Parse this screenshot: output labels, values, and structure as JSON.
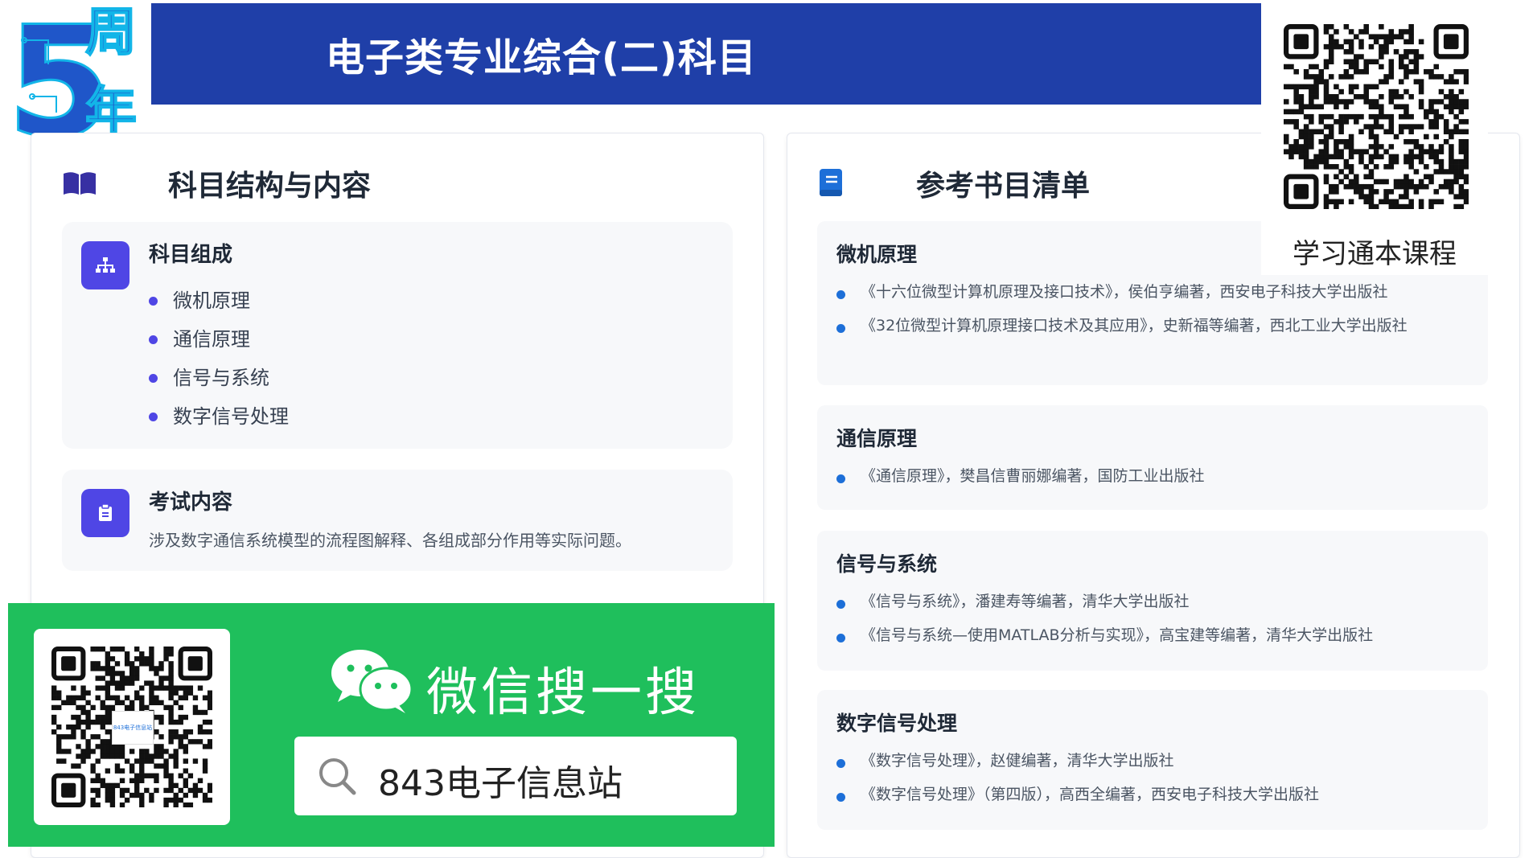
{
  "header": {
    "title": "电子类专业综合(二)科目"
  },
  "logo": {
    "number": "5",
    "text_top": "周",
    "text_bottom": "年"
  },
  "left_card": {
    "title": "科目结构与内容",
    "icon": "book-open-icon",
    "composition": {
      "heading": "科目组成",
      "icon": "hierarchy-icon",
      "items": [
        "微机原理",
        "通信原理",
        "信号与系统",
        "数字信号处理"
      ]
    },
    "exam": {
      "heading": "考试内容",
      "icon": "clipboard-icon",
      "description": "涉及数字通信系统模型的流程图解释、各组成部分作用等实际问题。"
    }
  },
  "right_card": {
    "title": "参考书目清单",
    "icon": "book-icon",
    "groups": [
      {
        "heading": "微机原理",
        "books": [
          "《十六位微型计算机原理及接口技术》，侯伯亨编著，西安电子科技大学出版社",
          "《32位微型计算机原理接口技术及其应用》，史新福等编著，西北工业大学出版社"
        ]
      },
      {
        "heading": "通信原理",
        "books": [
          "《通信原理》，樊昌信曹丽娜编著，国防工业出版社"
        ]
      },
      {
        "heading": "信号与系统",
        "books": [
          "《信号与系统》，潘建寿等编著，清华大学出版社",
          "《信号与系统—使用MATLAB分析与实现》，高宝建等编著，清华大学出版社"
        ]
      },
      {
        "heading": "数字信号处理",
        "books": [
          "《数字信号处理》，赵健编著，清华大学出版社",
          "《数字信号处理》（第四版），高西全编著，西安电子科技大学出版社"
        ]
      }
    ]
  },
  "qr_top": {
    "caption": "学习通本课程"
  },
  "wechat": {
    "title": "微信搜一搜",
    "search_text": "843电子信息站",
    "qr_logo_text": "843电子信息站"
  },
  "colors": {
    "header_bg": "#1f3fa8",
    "accent": "#4f46e5",
    "banner_green": "#1fbf5c",
    "bullet_blue": "#1d6fd8"
  }
}
